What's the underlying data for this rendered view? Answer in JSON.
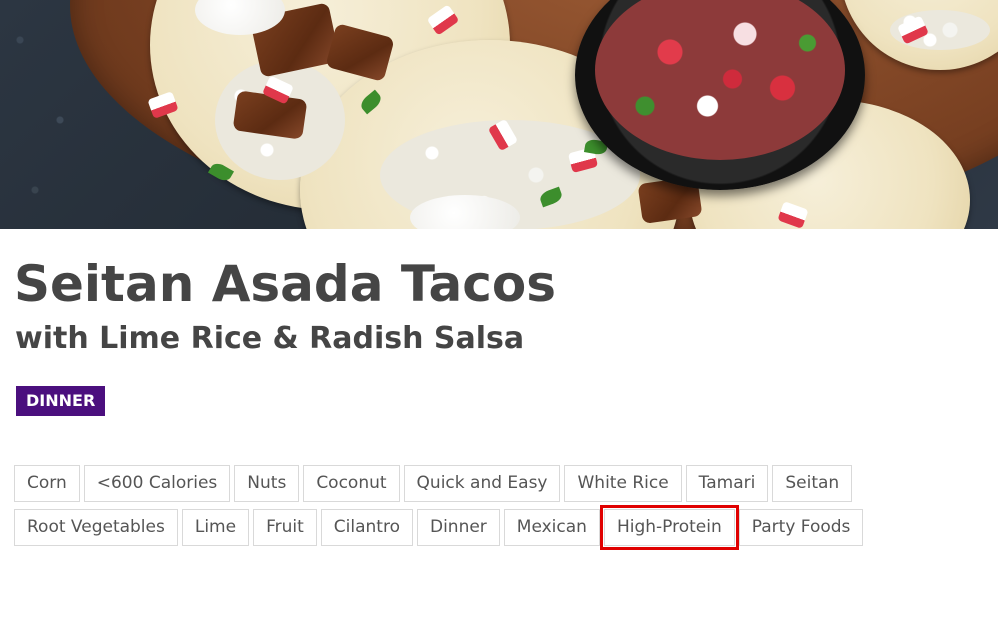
{
  "hero": {
    "alt": "Seitan Asada Tacos"
  },
  "recipe": {
    "title": "Seitan Asada Tacos",
    "subtitle": "with Lime Rice & Radish Salsa",
    "category": "DINNER"
  },
  "tags": {
    "row1": [
      "Corn",
      "<600 Calories",
      "Nuts",
      "Coconut",
      "Quick and Easy",
      "White Rice",
      "Tamari",
      "Seitan"
    ],
    "row2": [
      "Root Vegetables",
      "Lime",
      "Fruit",
      "Cilantro",
      "Dinner",
      "Mexican",
      "High-Protein",
      "Party Foods"
    ]
  },
  "colors": {
    "category_badge": "#4b0f7e",
    "title_text": "#454545",
    "highlight_outline": "#e00000"
  }
}
